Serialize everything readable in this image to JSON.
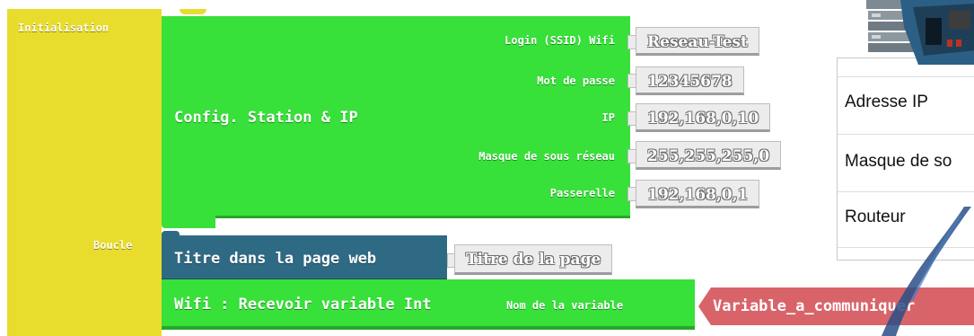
{
  "blocks": {
    "initialisation_label": "Initialisation",
    "boucle_label": "Boucle",
    "config": {
      "title": "Config. Station & IP",
      "fields": [
        {
          "label": "Login (SSID) Wifi",
          "value": "Reseau-Test"
        },
        {
          "label": "Mot de passe",
          "value": "12345678"
        },
        {
          "label": "IP",
          "value": "192,168,0,10"
        },
        {
          "label": "Masque de sous réseau",
          "value": "255,255,255,0"
        },
        {
          "label": "Passerelle",
          "value": "192,168,0,1"
        }
      ]
    },
    "page_title": {
      "label": "Titre dans la page web",
      "value": "Titre de la page"
    },
    "receive": {
      "label": "Wifi : Recevoir variable Int",
      "param_label": "Nom de la variable",
      "variable": "Variable_a_communiquer"
    }
  },
  "panel": {
    "rows": [
      "Adresse IP",
      "Masque de so",
      "Routeur"
    ]
  },
  "colors": {
    "yellow": "#e8dd2c",
    "green": "#38e03a",
    "blue": "#2f6a84",
    "red": "#d8646a",
    "gray": "#ececec"
  },
  "icons": [
    "router-device-icon",
    "pen-stroke-icon"
  ]
}
